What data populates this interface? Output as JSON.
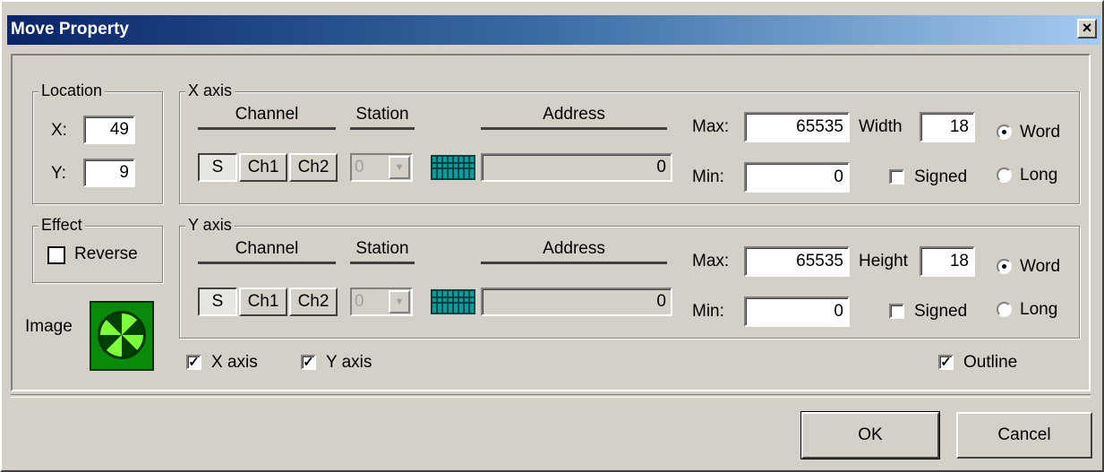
{
  "window": {
    "title": "Move Property",
    "close_glyph": "×"
  },
  "location": {
    "legend": "Location",
    "x_label": "X:",
    "x_value": "49",
    "y_label": "Y:",
    "y_value": "9"
  },
  "effect": {
    "legend": "Effect",
    "reverse_label": "Reverse",
    "reverse_checked": false
  },
  "image": {
    "label": "Image",
    "icon": "fan-icon"
  },
  "x_axis": {
    "legend": "X axis",
    "channel_label": "Channel",
    "station_label": "Station",
    "address_label": "Address",
    "channel_buttons": [
      "S",
      "Ch1",
      "Ch2"
    ],
    "station_value": "0",
    "address_value": "0",
    "max_label": "Max:",
    "max_value": "65535",
    "min_label": "Min:",
    "min_value": "0",
    "size_label": "Width",
    "size_value": "18",
    "signed_label": "Signed",
    "word_label": "Word",
    "long_label": "Long",
    "selected": "Word"
  },
  "y_axis": {
    "legend": "Y axis",
    "channel_label": "Channel",
    "station_label": "Station",
    "address_label": "Address",
    "channel_buttons": [
      "S",
      "Ch1",
      "Ch2"
    ],
    "station_value": "0",
    "address_value": "0",
    "max_label": "Max:",
    "max_value": "65535",
    "min_label": "Min:",
    "min_value": "0",
    "size_label": "Height",
    "size_value": "18",
    "signed_label": "Signed",
    "word_label": "Word",
    "long_label": "Long",
    "selected": "Word"
  },
  "checks": {
    "x_axis_label": "X axis",
    "y_axis_label": "Y axis",
    "outline_label": "Outline",
    "checked_glyph": "✓"
  },
  "buttons": {
    "ok": "OK",
    "cancel": "Cancel"
  },
  "colors": {
    "title_start": "#0a246a",
    "title_end": "#a6caf0",
    "face": "#d4d0c8",
    "image_green": "#0a8a0a"
  }
}
